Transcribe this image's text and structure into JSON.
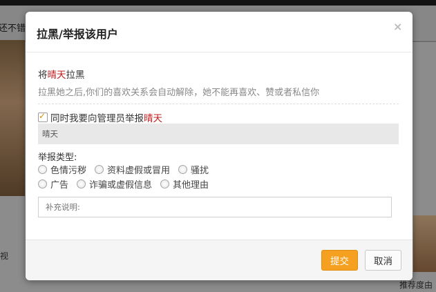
{
  "background": {
    "strip_text": "还不错",
    "left_text": "视",
    "right_text": "推荐度由"
  },
  "dialog": {
    "title": "拉黑/举报该用户",
    "close_symbol": "×",
    "block_prefix": "将",
    "user_name": "晴天",
    "block_suffix": "拉黑",
    "description": "拉黑她之后,你们的喜欢关系会自动解除，她不能再喜欢、赞或者私信你",
    "report_checkbox": {
      "checked": true,
      "label_prefix": "同时我要向管理员举报",
      "user_name": "晴天"
    },
    "report_target_name": "晴天",
    "report_type_label": "举报类型:",
    "report_types_row1": [
      "色情污秽",
      "资料虚假或冒用",
      "骚扰"
    ],
    "report_types_row2": [
      "广告",
      "诈骗或虚假信息",
      "其他理由"
    ],
    "note_placeholder": "补充说明:",
    "submit_label": "提交",
    "cancel_label": "取消"
  },
  "colors": {
    "highlight": "#c21c1c",
    "submit_bg": "#f5a020",
    "checkbox_tick": "#e08a00"
  }
}
